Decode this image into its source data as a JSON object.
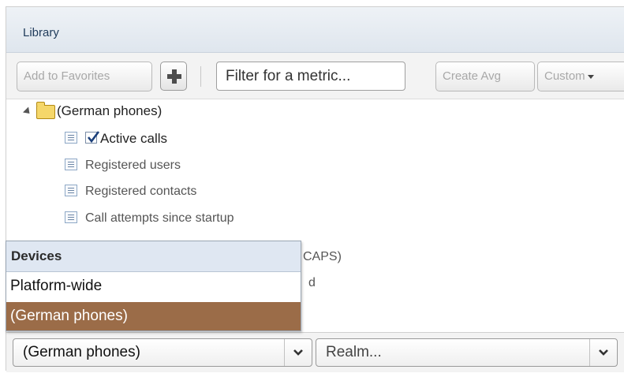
{
  "panel": {
    "title": "Library"
  },
  "toolbar": {
    "add_favorites_label": "Add to Favorites",
    "filter_text": "Filter for a metric...",
    "create_avg_label": "Create Avg",
    "custom_label": "Custom"
  },
  "tree": {
    "group_label": "(German phones)",
    "items": [
      {
        "label": "Active calls",
        "checked": true
      },
      {
        "label": "Registered users"
      },
      {
        "label": "Registered contacts"
      },
      {
        "label": "Call attempts since startup"
      },
      {
        "label_partial": "CAPS)"
      },
      {
        "label_partial": "d"
      }
    ]
  },
  "devices_dropdown": {
    "header": "Devices",
    "options": [
      "Platform-wide",
      "(German phones)"
    ],
    "selected": "(German phones)"
  },
  "bottom": {
    "device_select_value": "(German phones)",
    "realm_select_value": "Realm..."
  },
  "colors": {
    "selected_option_bg": "#9b6c48",
    "header_bg": "#e6ecf3",
    "dropdown_header_bg": "#dfe7f2"
  }
}
